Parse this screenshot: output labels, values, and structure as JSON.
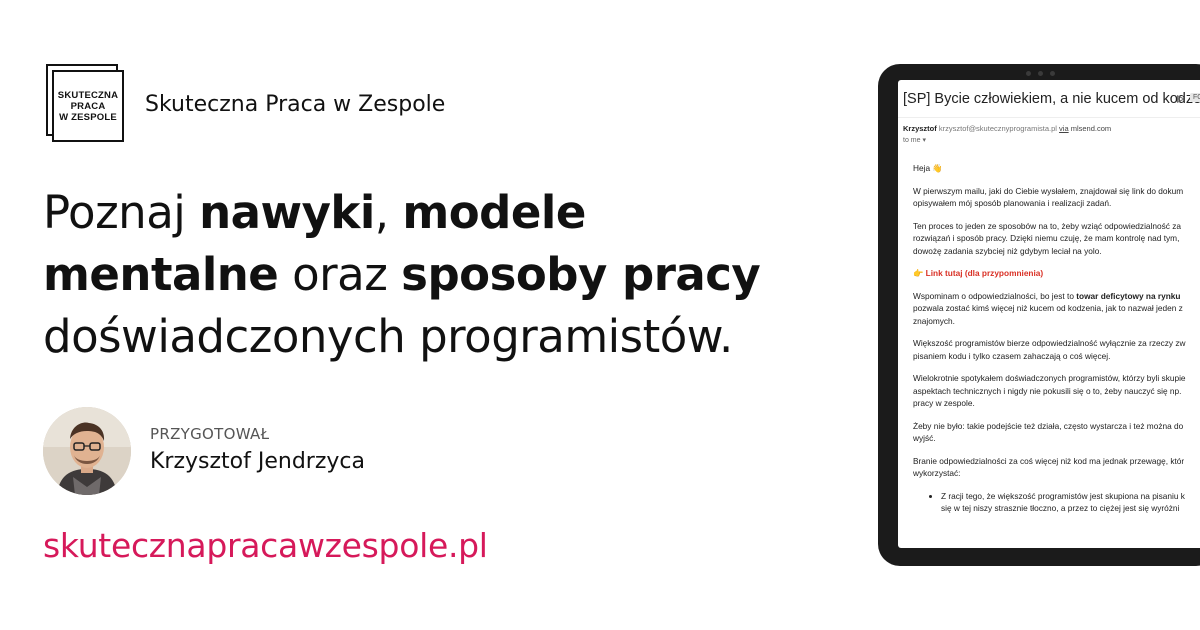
{
  "brand": {
    "logo_lines": [
      "SKUTECZNA",
      "PRACA",
      "W ZESPOLE"
    ],
    "name": "Skuteczna Praca w Zespole"
  },
  "headline": {
    "parts": [
      {
        "text": "Poznaj ",
        "bold": false
      },
      {
        "text": "nawyki",
        "bold": true
      },
      {
        "text": ", ",
        "bold": false
      },
      {
        "text": "modele",
        "bold": true
      },
      {
        "text": "mentalne",
        "bold": true
      },
      {
        "text": " oraz ",
        "bold": false
      },
      {
        "text": "sposoby pracy",
        "bold": true
      },
      {
        "text": "doświadczonych programistów.",
        "bold": false
      }
    ]
  },
  "author": {
    "label": "PRZYGOTOWAŁ",
    "name": "Krzysztof Jendrzyca"
  },
  "url": "skutecznapracawzespole.pl",
  "colors": {
    "accent": "#d6195a",
    "tablet_frame": "#1b1b1b",
    "link_red": "#d93025"
  },
  "email": {
    "subject": "[SP] Bycie człowiekiem, a nie kucem od kodzenia",
    "subject_icon": "label-arrow-icon",
    "subject_badge": "FO",
    "sender_name": "Krzysztof",
    "sender_address": "krzysztof@skutecznyprogramista.pl",
    "via_label": "via",
    "via_domain": "mlsend.com",
    "to": "to me ▾",
    "greeting": "Heja 👋",
    "p1": "W pierwszym mailu, jaki do Ciebie wysłałem, znajdował się link do dokum\nopisywałem mój sposób planowania i realizacji zadań.",
    "p2": "Ten proces to jeden ze sposobów na to, żeby wziąć odpowiedzialność za\nrozwiązań i sposób pracy. Dzięki niemu czuję, że mam kontrolę nad tym,\ndowożę zadania szybciej niż gdybym leciał na yolo.",
    "link": "👉 Link tutaj (dla przypomnienia)",
    "p3_before": "Wspominam o odpowiedzialności, bo jest to ",
    "p3_bold": "towar deficytowy na rynku",
    "p3_after": "\npozwala zostać kimś więcej niż kucem od kodzenia, jak to nazwał jeden z\nznajomych.",
    "p4": "Większość programistów bierze odpowiedzialność wyłącznie za rzeczy zw\npisaniem kodu i tylko czasem zahaczają o coś więcej.",
    "p5": "Wielokrotnie spotykałem doświadczonych programistów, którzy byli skupie\naspektach technicznych i nigdy nie pokusili się o to, żeby nauczyć się np.\npracy w zespole.",
    "p6": "Żeby nie było: takie podejście też działa, często wystarcza i też można do\nwyjść.",
    "p7": "Branie odpowiedzialności za coś więcej niż kod ma jednak przewagę, któr\nwykorzystać:",
    "bullet1": "Z racji tego, że większość programistów jest skupiona na pisaniu k\nsię w tej niszy strasznie tłoczno, a przez to ciężej jest się wyróżni"
  }
}
